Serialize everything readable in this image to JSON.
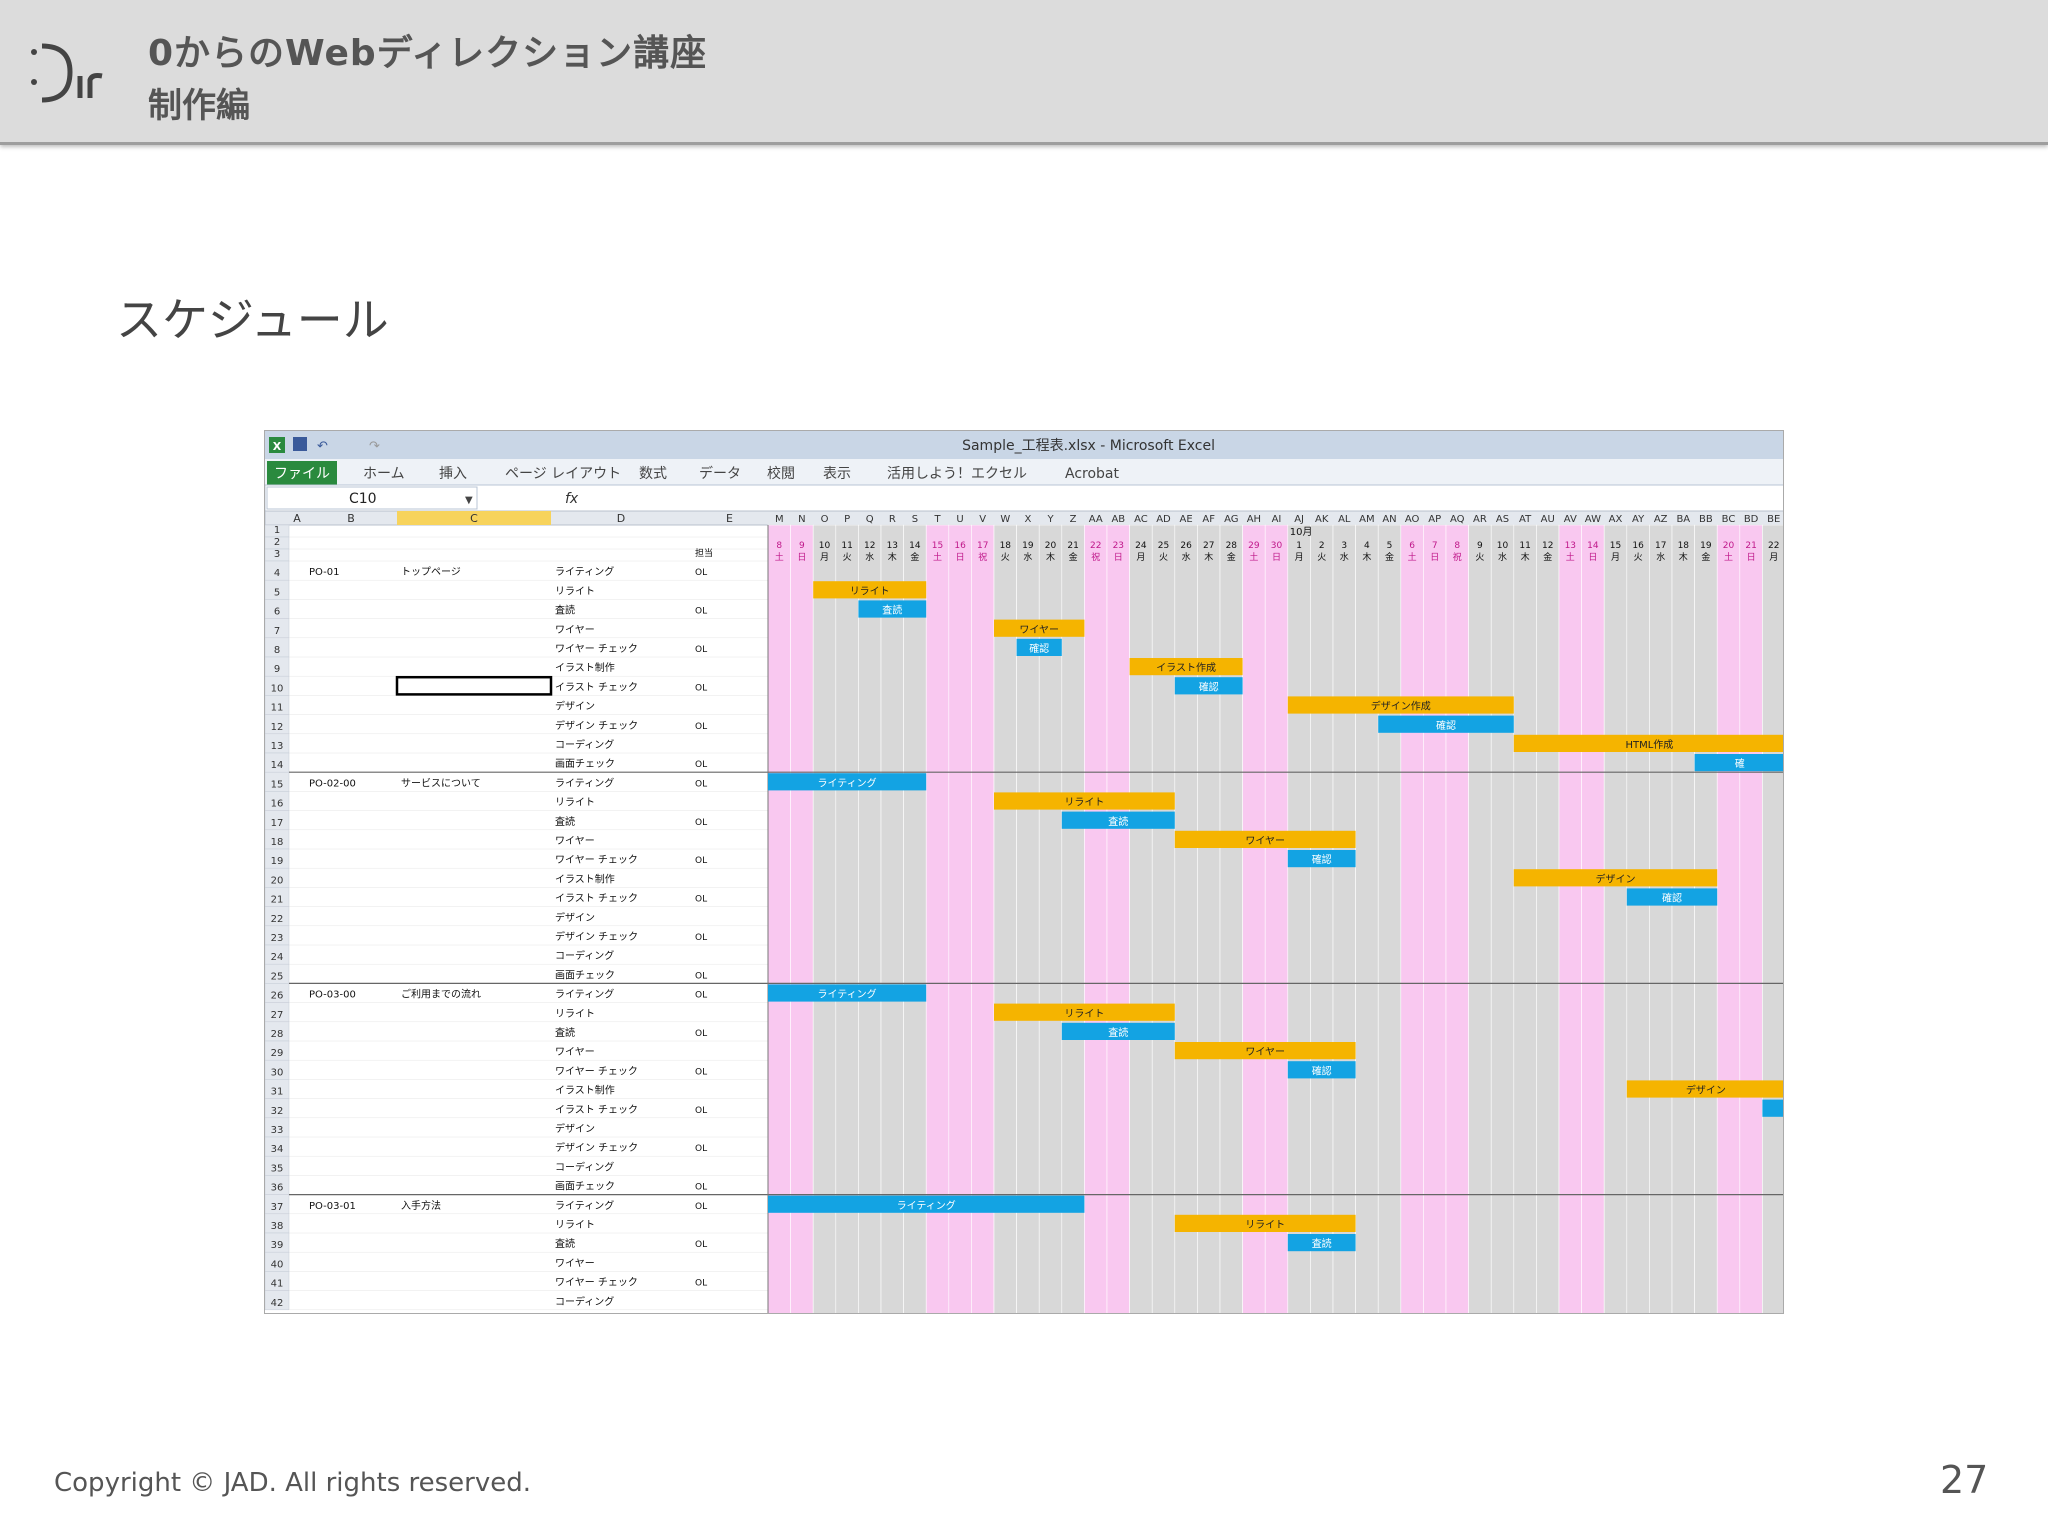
{
  "header": {
    "title": "0からのWebディレクション講座",
    "subtitle": "制作編",
    "logo_text": "Dir"
  },
  "slide": {
    "title": "スケジュール"
  },
  "excel": {
    "window_title": "Sample_工程表.xlsx - Microsoft Excel",
    "ribbon_tabs": [
      "ファイル",
      "ホーム",
      "挿入",
      "ページ レイアウト",
      "数式",
      "データ",
      "校閲",
      "表示",
      "活用しよう！エクセル",
      "Acrobat"
    ],
    "name_box": "C10",
    "formula_icon": "fx",
    "row_col_letters_left": [
      "A",
      "B",
      "C",
      "D",
      "E"
    ],
    "date_col_letters": [
      "M",
      "N",
      "O",
      "P",
      "Q",
      "R",
      "S",
      "T",
      "U",
      "V",
      "W",
      "X",
      "Y",
      "Z",
      "AA",
      "AB",
      "AC",
      "AD",
      "AE",
      "AF",
      "AG",
      "AH",
      "AI",
      "AJ",
      "AK",
      "AL",
      "AM",
      "AN",
      "AO",
      "AP",
      "AQ",
      "AR",
      "AS",
      "AT",
      "AU",
      "AV",
      "AW",
      "AX",
      "AY",
      "AZ",
      "BA",
      "BB",
      "BC",
      "BD",
      "BE"
    ],
    "month_label": "10月",
    "dates": [
      "8",
      "9",
      "10",
      "11",
      "12",
      "13",
      "14",
      "15",
      "16",
      "17",
      "18",
      "19",
      "20",
      "21",
      "22",
      "23",
      "24",
      "25",
      "26",
      "27",
      "28",
      "29",
      "30",
      "1",
      "2",
      "3",
      "4",
      "5",
      "6",
      "7",
      "8",
      "9",
      "10",
      "11",
      "12",
      "13",
      "14",
      "15",
      "16",
      "17",
      "18",
      "19",
      "20",
      "21",
      "22"
    ],
    "weekdays": [
      "土",
      "日",
      "月",
      "火",
      "水",
      "木",
      "金",
      "土",
      "日",
      "祝",
      "火",
      "水",
      "木",
      "金",
      "祝",
      "日",
      "月",
      "火",
      "水",
      "木",
      "金",
      "土",
      "日",
      "月",
      "火",
      "水",
      "木",
      "金",
      "土",
      "日",
      "祝",
      "火",
      "水",
      "木",
      "金",
      "土",
      "日",
      "月",
      "火",
      "水",
      "木",
      "金",
      "土",
      "日",
      "月"
    ],
    "pink_cols": [
      0,
      1,
      7,
      8,
      9,
      14,
      15,
      21,
      22,
      28,
      29,
      30,
      35,
      36,
      42,
      43
    ],
    "header_e": "担当",
    "rows": [
      {
        "n": "1",
        "b": "",
        "c": "",
        "d": "",
        "e": ""
      },
      {
        "n": "2",
        "b": "",
        "c": "",
        "d": "",
        "e": ""
      },
      {
        "n": "3",
        "b": "",
        "c": "",
        "d": "",
        "e": "担当"
      },
      {
        "n": "4",
        "b": "PO-01",
        "c": "トップページ",
        "d": "ライティング",
        "e": "OL"
      },
      {
        "n": "5",
        "b": "",
        "c": "",
        "d": "リライト",
        "e": ""
      },
      {
        "n": "6",
        "b": "",
        "c": "",
        "d": "査読",
        "e": "OL"
      },
      {
        "n": "7",
        "b": "",
        "c": "",
        "d": "ワイヤー",
        "e": ""
      },
      {
        "n": "8",
        "b": "",
        "c": "",
        "d": "ワイヤー チェック",
        "e": "OL"
      },
      {
        "n": "9",
        "b": "",
        "c": "",
        "d": "イラスト制作",
        "e": ""
      },
      {
        "n": "10",
        "b": "",
        "c": "",
        "d": "イラスト チェック",
        "e": "OL"
      },
      {
        "n": "11",
        "b": "",
        "c": "",
        "d": "デザイン",
        "e": ""
      },
      {
        "n": "12",
        "b": "",
        "c": "",
        "d": "デザイン チェック",
        "e": "OL"
      },
      {
        "n": "13",
        "b": "",
        "c": "",
        "d": "コーディング",
        "e": ""
      },
      {
        "n": "14",
        "b": "",
        "c": "",
        "d": "画面チェック",
        "e": "OL"
      },
      {
        "n": "15",
        "b": "PO-02-00",
        "c": "サービスについて",
        "d": "ライティング",
        "e": "OL"
      },
      {
        "n": "16",
        "b": "",
        "c": "",
        "d": "リライト",
        "e": ""
      },
      {
        "n": "17",
        "b": "",
        "c": "",
        "d": "査読",
        "e": "OL"
      },
      {
        "n": "18",
        "b": "",
        "c": "",
        "d": "ワイヤー",
        "e": ""
      },
      {
        "n": "19",
        "b": "",
        "c": "",
        "d": "ワイヤー チェック",
        "e": "OL"
      },
      {
        "n": "20",
        "b": "",
        "c": "",
        "d": "イラスト制作",
        "e": ""
      },
      {
        "n": "21",
        "b": "",
        "c": "",
        "d": "イラスト チェック",
        "e": "OL"
      },
      {
        "n": "22",
        "b": "",
        "c": "",
        "d": "デザイン",
        "e": ""
      },
      {
        "n": "23",
        "b": "",
        "c": "",
        "d": "デザイン チェック",
        "e": "OL"
      },
      {
        "n": "24",
        "b": "",
        "c": "",
        "d": "コーディング",
        "e": ""
      },
      {
        "n": "25",
        "b": "",
        "c": "",
        "d": "画面チェック",
        "e": "OL"
      },
      {
        "n": "26",
        "b": "PO-03-00",
        "c": "ご利用までの流れ",
        "d": "ライティング",
        "e": "OL"
      },
      {
        "n": "27",
        "b": "",
        "c": "",
        "d": "リライト",
        "e": ""
      },
      {
        "n": "28",
        "b": "",
        "c": "",
        "d": "査読",
        "e": "OL"
      },
      {
        "n": "29",
        "b": "",
        "c": "",
        "d": "ワイヤー",
        "e": ""
      },
      {
        "n": "30",
        "b": "",
        "c": "",
        "d": "ワイヤー チェック",
        "e": "OL"
      },
      {
        "n": "31",
        "b": "",
        "c": "",
        "d": "イラスト制作",
        "e": ""
      },
      {
        "n": "32",
        "b": "",
        "c": "",
        "d": "イラスト チェック",
        "e": "OL"
      },
      {
        "n": "33",
        "b": "",
        "c": "",
        "d": "デザイン",
        "e": ""
      },
      {
        "n": "34",
        "b": "",
        "c": "",
        "d": "デザイン チェック",
        "e": "OL"
      },
      {
        "n": "35",
        "b": "",
        "c": "",
        "d": "コーディング",
        "e": ""
      },
      {
        "n": "36",
        "b": "",
        "c": "",
        "d": "画面チェック",
        "e": "OL"
      },
      {
        "n": "37",
        "b": "PO-03-01",
        "c": "入手方法",
        "d": "ライティング",
        "e": "OL"
      },
      {
        "n": "38",
        "b": "",
        "c": "",
        "d": "リライト",
        "e": ""
      },
      {
        "n": "39",
        "b": "",
        "c": "",
        "d": "査読",
        "e": "OL"
      },
      {
        "n": "40",
        "b": "",
        "c": "",
        "d": "ワイヤー",
        "e": ""
      },
      {
        "n": "41",
        "b": "",
        "c": "",
        "d": "ワイヤー チェック",
        "e": "OL"
      },
      {
        "n": "42",
        "b": "",
        "c": "",
        "d": "コーディング",
        "e": ""
      }
    ],
    "bars": [
      {
        "row": 5,
        "start": 2,
        "len": 5,
        "color": "orange",
        "label": "リライト"
      },
      {
        "row": 6,
        "start": 4,
        "len": 3,
        "color": "blue",
        "label": "査読"
      },
      {
        "row": 7,
        "start": 10,
        "len": 4,
        "color": "orange",
        "label": "ワイヤー"
      },
      {
        "row": 8,
        "start": 11,
        "len": 2,
        "color": "blue",
        "label": "確認"
      },
      {
        "row": 9,
        "start": 16,
        "len": 5,
        "color": "orange",
        "label": "イラスト作成"
      },
      {
        "row": 10,
        "start": 18,
        "len": 3,
        "color": "blue",
        "label": "確認"
      },
      {
        "row": 11,
        "start": 23,
        "len": 10,
        "color": "orange",
        "label": "デザイン作成"
      },
      {
        "row": 12,
        "start": 27,
        "len": 6,
        "color": "blue",
        "label": "確認"
      },
      {
        "row": 13,
        "start": 33,
        "len": 12,
        "color": "orange",
        "label": "HTML作成"
      },
      {
        "row": 14,
        "start": 41,
        "len": 4,
        "color": "blue",
        "label": "確"
      },
      {
        "row": 15,
        "start": 0,
        "len": 7,
        "color": "blue",
        "label": "ライティング"
      },
      {
        "row": 16,
        "start": 10,
        "len": 8,
        "color": "orange",
        "label": "リライト"
      },
      {
        "row": 17,
        "start": 13,
        "len": 5,
        "color": "blue",
        "label": "査読"
      },
      {
        "row": 18,
        "start": 18,
        "len": 8,
        "color": "orange",
        "label": "ワイヤー"
      },
      {
        "row": 19,
        "start": 23,
        "len": 3,
        "color": "blue",
        "label": "確認"
      },
      {
        "row": 20,
        "start": 33,
        "len": 9,
        "color": "orange",
        "label": "デザイン"
      },
      {
        "row": 21,
        "start": 38,
        "len": 4,
        "color": "blue",
        "label": "確認"
      },
      {
        "row": 26,
        "start": 0,
        "len": 7,
        "color": "blue",
        "label": "ライティング"
      },
      {
        "row": 27,
        "start": 10,
        "len": 8,
        "color": "orange",
        "label": "リライト"
      },
      {
        "row": 28,
        "start": 13,
        "len": 5,
        "color": "blue",
        "label": "査読"
      },
      {
        "row": 29,
        "start": 18,
        "len": 8,
        "color": "orange",
        "label": "ワイヤー"
      },
      {
        "row": 30,
        "start": 23,
        "len": 3,
        "color": "blue",
        "label": "確認"
      },
      {
        "row": 31,
        "start": 38,
        "len": 7,
        "color": "orange",
        "label": "デザイン"
      },
      {
        "row": 32,
        "start": 44,
        "len": 1,
        "color": "blue",
        "label": ""
      },
      {
        "row": 37,
        "start": 0,
        "len": 14,
        "color": "blue",
        "label": "ライティング"
      },
      {
        "row": 38,
        "start": 18,
        "len": 8,
        "color": "orange",
        "label": "リライト"
      },
      {
        "row": 39,
        "start": 23,
        "len": 3,
        "color": "blue",
        "label": "査読"
      }
    ],
    "colors": {
      "orange": "#f5b400",
      "blue": "#13a3e3",
      "pink": "#f9c8f0",
      "gray": "#d8d8d8",
      "ribbon_green": "#2a8a3e"
    }
  },
  "footer": {
    "copyright": "Copyright © JAD. All rights reserved.",
    "page_number": "27"
  }
}
